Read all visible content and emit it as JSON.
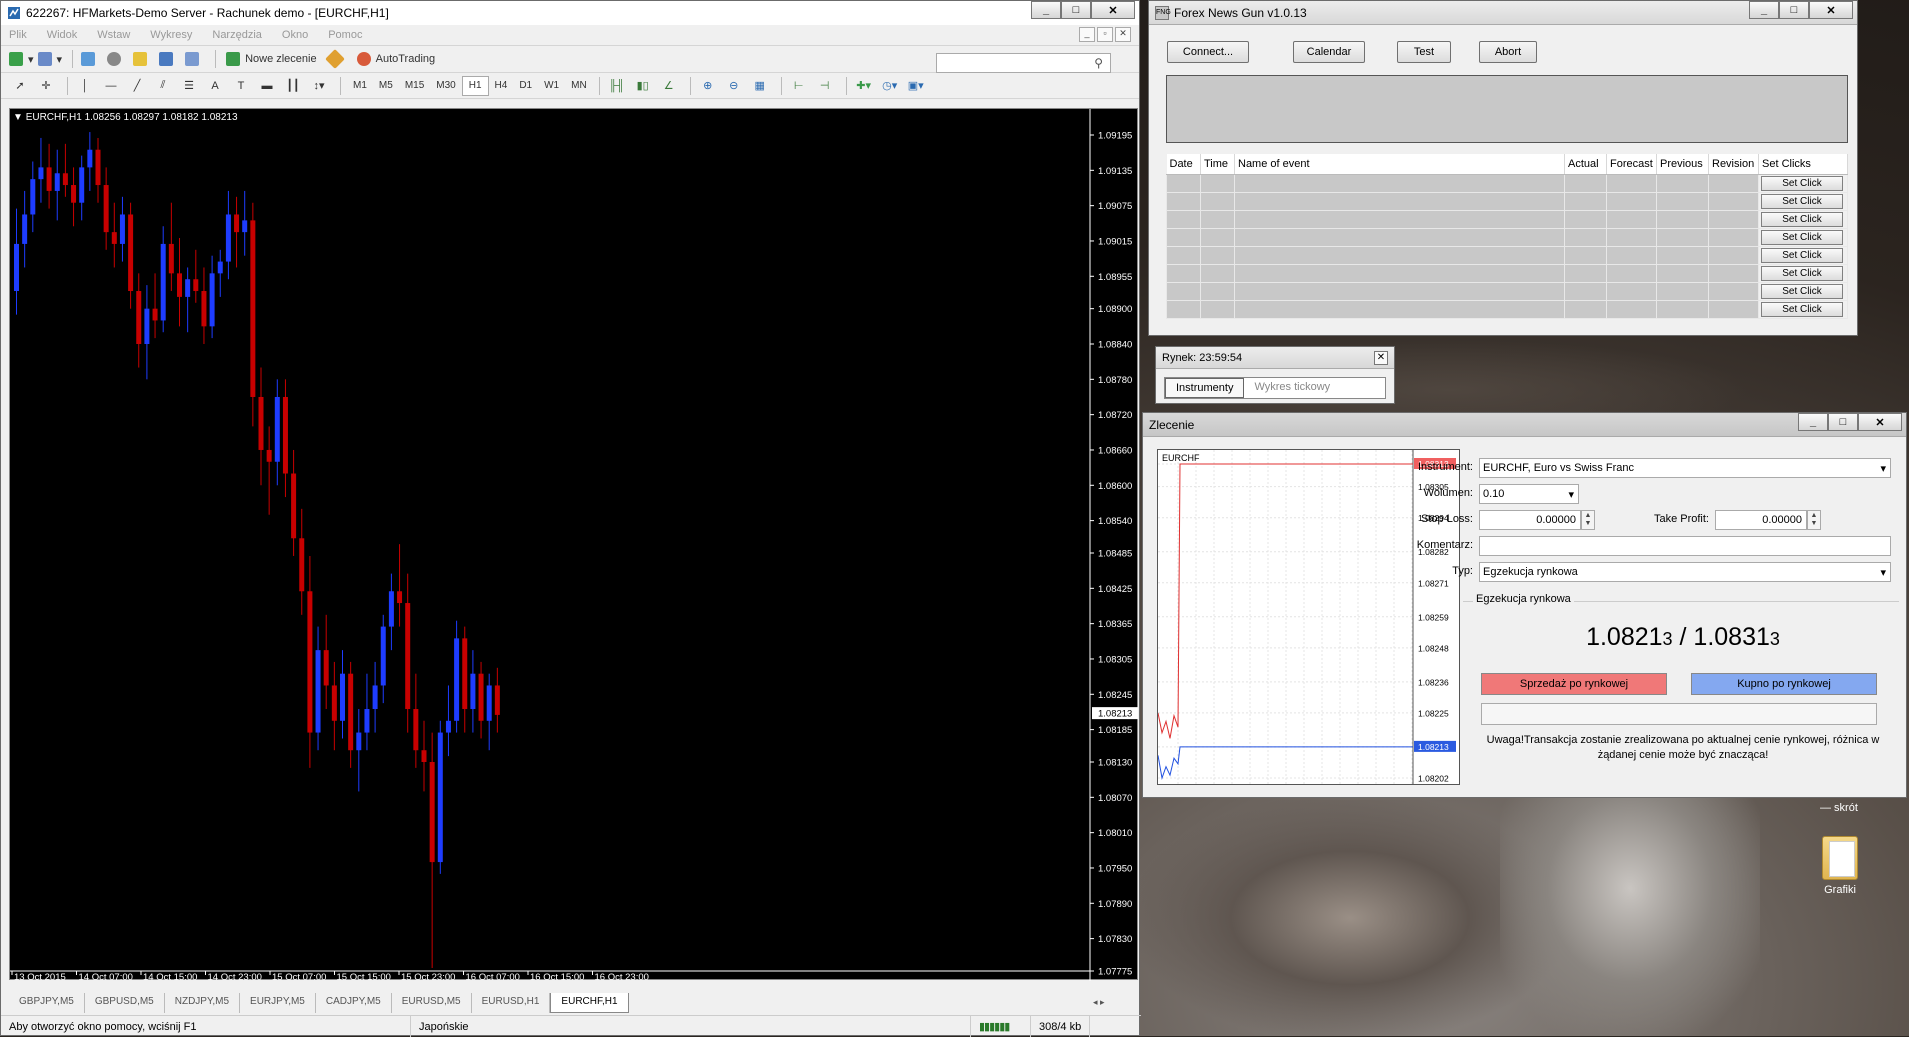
{
  "mt4": {
    "title": "622267: HFMarkets-Demo Server - Rachunek demo - [EURCHF,H1]",
    "menu": [
      "Plik",
      "Widok",
      "Wstaw",
      "Wykresy",
      "Narzędzia",
      "Okno",
      "Pomoc"
    ],
    "toolbar": {
      "new_order": "Nowe zlecenie",
      "autotrading": "AutoTrading"
    },
    "timeframes": [
      "M1",
      "M5",
      "M15",
      "M30",
      "H1",
      "H4",
      "D1",
      "W1",
      "MN"
    ],
    "active_timeframe": "H1",
    "chart_header": "EURCHF,H1  1.08256 1.08297 1.08182 1.08213",
    "price_labels": [
      "1.09195",
      "1.09135",
      "1.09075",
      "1.09015",
      "1.08955",
      "1.08900",
      "1.08840",
      "1.08780",
      "1.08720",
      "1.08660",
      "1.08600",
      "1.08540",
      "1.08485",
      "1.08425",
      "1.08365",
      "1.08305",
      "1.08245",
      "1.08185",
      "1.08130",
      "1.08070",
      "1.08010",
      "1.07950",
      "1.07890",
      "1.07830",
      "1.07775"
    ],
    "current_price": "1.08213",
    "time_labels": [
      "13 Oct 2015",
      "14 Oct 07:00",
      "14 Oct 15:00",
      "14 Oct 23:00",
      "15 Oct 07:00",
      "15 Oct 15:00",
      "15 Oct 23:00",
      "16 Oct 07:00",
      "16 Oct 15:00",
      "16 Oct 23:00"
    ],
    "tabs": [
      "GBPJPY,M5",
      "GBPUSD,M5",
      "NZDJPY,M5",
      "EURJPY,M5",
      "CADJPY,M5",
      "EURUSD,M5",
      "EURUSD,H1",
      "EURCHF,H1"
    ],
    "active_tab": "EURCHF,H1",
    "status": {
      "help": "Aby otworzyć okno pomocy, wciśnij F1",
      "profile": "Japońskie",
      "traffic": "308/4 kb"
    },
    "colors": {
      "bull": "#1e3cff",
      "bear": "#c80000",
      "background": "#000000"
    }
  },
  "chart_data": {
    "type": "candlestick",
    "symbol": "EURCHF",
    "timeframe": "H1",
    "ylim": [
      1.07775,
      1.09195
    ],
    "ohlc": [
      [
        1.0893,
        1.0907,
        1.0889,
        1.0901
      ],
      [
        1.0901,
        1.091,
        1.0897,
        1.0906
      ],
      [
        1.0906,
        1.0915,
        1.0903,
        1.0912
      ],
      [
        1.0912,
        1.0919,
        1.0908,
        1.0914
      ],
      [
        1.0914,
        1.0918,
        1.0907,
        1.091
      ],
      [
        1.091,
        1.0917,
        1.0905,
        1.0913
      ],
      [
        1.0913,
        1.0918,
        1.0909,
        1.0911
      ],
      [
        1.0911,
        1.0914,
        1.0904,
        1.0908
      ],
      [
        1.0908,
        1.0916,
        1.0905,
        1.0914
      ],
      [
        1.0914,
        1.092,
        1.091,
        1.0917
      ],
      [
        1.0917,
        1.0919,
        1.0908,
        1.0911
      ],
      [
        1.0911,
        1.0914,
        1.09,
        1.0903
      ],
      [
        1.0903,
        1.0908,
        1.0897,
        1.0901
      ],
      [
        1.0901,
        1.0909,
        1.0898,
        1.0906
      ],
      [
        1.0906,
        1.0908,
        1.089,
        1.0893
      ],
      [
        1.0893,
        1.0896,
        1.088,
        1.0884
      ],
      [
        1.0884,
        1.0894,
        1.0878,
        1.089
      ],
      [
        1.089,
        1.0896,
        1.0885,
        1.0888
      ],
      [
        1.0888,
        1.0904,
        1.0886,
        1.0901
      ],
      [
        1.0901,
        1.0908,
        1.0893,
        1.0896
      ],
      [
        1.0896,
        1.0902,
        1.0887,
        1.0892
      ],
      [
        1.0892,
        1.0897,
        1.0886,
        1.0895
      ],
      [
        1.0895,
        1.09,
        1.0891,
        1.0893
      ],
      [
        1.0893,
        1.0897,
        1.0884,
        1.0887
      ],
      [
        1.0887,
        1.0899,
        1.0885,
        1.0896
      ],
      [
        1.0896,
        1.09,
        1.0892,
        1.0898
      ],
      [
        1.0898,
        1.091,
        1.0895,
        1.0906
      ],
      [
        1.0906,
        1.0909,
        1.0897,
        1.0903
      ],
      [
        1.0903,
        1.091,
        1.0899,
        1.0905
      ],
      [
        1.0905,
        1.0908,
        1.087,
        1.0875
      ],
      [
        1.0875,
        1.088,
        1.086,
        1.0866
      ],
      [
        1.0866,
        1.087,
        1.0855,
        1.0864
      ],
      [
        1.0864,
        1.0878,
        1.086,
        1.0875
      ],
      [
        1.0875,
        1.0878,
        1.0858,
        1.0862
      ],
      [
        1.0862,
        1.0866,
        1.0848,
        1.0851
      ],
      [
        1.0851,
        1.0856,
        1.0838,
        1.0842
      ],
      [
        1.0842,
        1.0848,
        1.0812,
        1.0818
      ],
      [
        1.0818,
        1.0836,
        1.0815,
        1.0832
      ],
      [
        1.0832,
        1.0838,
        1.0822,
        1.0826
      ],
      [
        1.0826,
        1.083,
        1.0815,
        1.082
      ],
      [
        1.082,
        1.0832,
        1.0817,
        1.0828
      ],
      [
        1.0828,
        1.083,
        1.0812,
        1.0815
      ],
      [
        1.0815,
        1.0822,
        1.0808,
        1.0818
      ],
      [
        1.0818,
        1.0828,
        1.0815,
        1.0822
      ],
      [
        1.0822,
        1.083,
        1.0818,
        1.0826
      ],
      [
        1.0826,
        1.0838,
        1.0823,
        1.0836
      ],
      [
        1.0836,
        1.0845,
        1.0832,
        1.0842
      ],
      [
        1.0842,
        1.085,
        1.0836,
        1.084
      ],
      [
        1.084,
        1.0845,
        1.0818,
        1.0822
      ],
      [
        1.0822,
        1.0828,
        1.0812,
        1.0815
      ],
      [
        1.0815,
        1.082,
        1.0808,
        1.0813
      ],
      [
        1.0813,
        1.0818,
        1.0778,
        1.0796
      ],
      [
        1.0796,
        1.082,
        1.0794,
        1.0818
      ],
      [
        1.0818,
        1.0826,
        1.0814,
        1.082
      ],
      [
        1.082,
        1.0837,
        1.0818,
        1.0834
      ],
      [
        1.0834,
        1.0836,
        1.0818,
        1.0822
      ],
      [
        1.0822,
        1.0832,
        1.0818,
        1.0828
      ],
      [
        1.0828,
        1.083,
        1.0817,
        1.082
      ],
      [
        1.082,
        1.0828,
        1.0815,
        1.0826
      ],
      [
        1.0826,
        1.0829,
        1.0818,
        1.0821
      ]
    ]
  },
  "fng": {
    "title": "Forex News Gun v1.0.13",
    "buttons": [
      "Connect...",
      "Calendar",
      "Test",
      "Abort"
    ],
    "columns": [
      "Date",
      "Time",
      "Name of event",
      "Actual",
      "Forecast",
      "Previous",
      "Revision",
      "Set Clicks"
    ],
    "row_button": "Set Click",
    "rows": 8
  },
  "rynek": {
    "title": "Rynek: 23:59:54",
    "tab1": "Instrumenty",
    "tab2": "Wykres tickowy"
  },
  "zlecenie": {
    "title": "Zlecenie",
    "chart_symbol": "EURCHF",
    "mini_prices": [
      "1.08313",
      "1.08305",
      "1.08294",
      "1.08282",
      "1.08271",
      "1.08259",
      "1.08248",
      "1.08236",
      "1.08225",
      "1.08213",
      "1.08202"
    ],
    "ask_tag": "1.08313",
    "bid_tag": "1.08213",
    "labels": {
      "instrument": "Instrument:",
      "volume": "Wolumen:",
      "sl": "Stop Loss:",
      "tp": "Take Profit:",
      "comment": "Komentarz:",
      "type": "Typ:"
    },
    "instrument": "EURCHF, Euro vs Swiss Franc",
    "volume": "0.10",
    "stop_loss": "0.00000",
    "take_profit": "0.00000",
    "comment": "",
    "type": "Egzekucja rynkowa",
    "group_label": "Egzekucja rynkowa",
    "bid_main": "1.0821",
    "bid_small": "3",
    "ask_main": "1.0831",
    "ask_small": "3",
    "price_separator": "/",
    "sell": "Sprzedaż po rynkowej",
    "buy": "Kupno po rynkowej",
    "warning": "Uwaga!Transakcja zostanie zrealizowana po aktualnej cenie rynkowej, różnica w żądanej cenie może być znacząca!"
  },
  "desktop": {
    "shortcut_label": "— skrót",
    "folder": "Grafiki"
  }
}
